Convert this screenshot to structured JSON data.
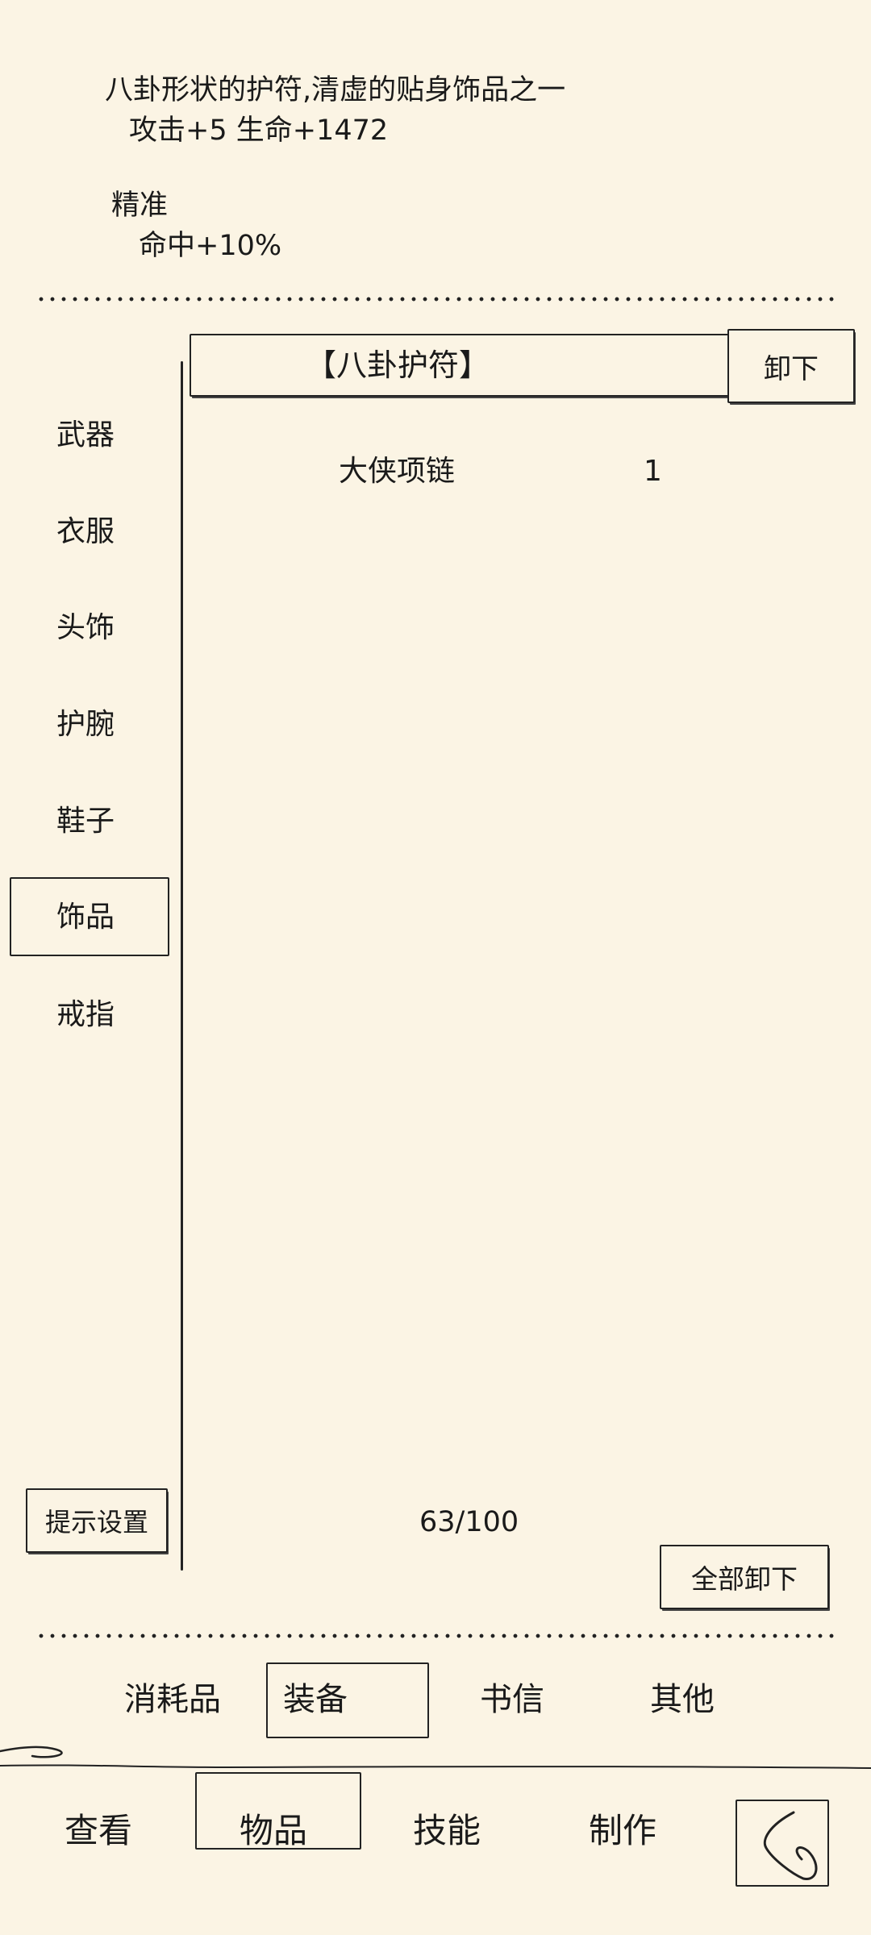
{
  "detail": {
    "description": "八卦形状的护符,清虚的贴身饰品之一",
    "stats": "攻击+5 生命+1472",
    "trait_name": "精准",
    "trait_effect": "命中+10%"
  },
  "equipped": {
    "name": "【八卦护符】",
    "unequip_label": "卸下"
  },
  "sidebar": {
    "items": [
      {
        "label": "武器"
      },
      {
        "label": "衣服"
      },
      {
        "label": "头饰"
      },
      {
        "label": "护腕"
      },
      {
        "label": "鞋子"
      },
      {
        "label": "饰品"
      },
      {
        "label": "戒指"
      }
    ],
    "selected": "饰品",
    "hint_settings_label": "提示设置"
  },
  "inventory": {
    "items": [
      {
        "name": "大侠项链",
        "count": "1"
      }
    ],
    "capacity": "63/100",
    "unequip_all_label": "全部卸下"
  },
  "bag_tabs": {
    "items": [
      "消耗品",
      "装备",
      "书信",
      "其他"
    ],
    "selected": "装备"
  },
  "nav": {
    "items": [
      "查看",
      "物品",
      "技能",
      "制作"
    ],
    "selected": "物品"
  }
}
